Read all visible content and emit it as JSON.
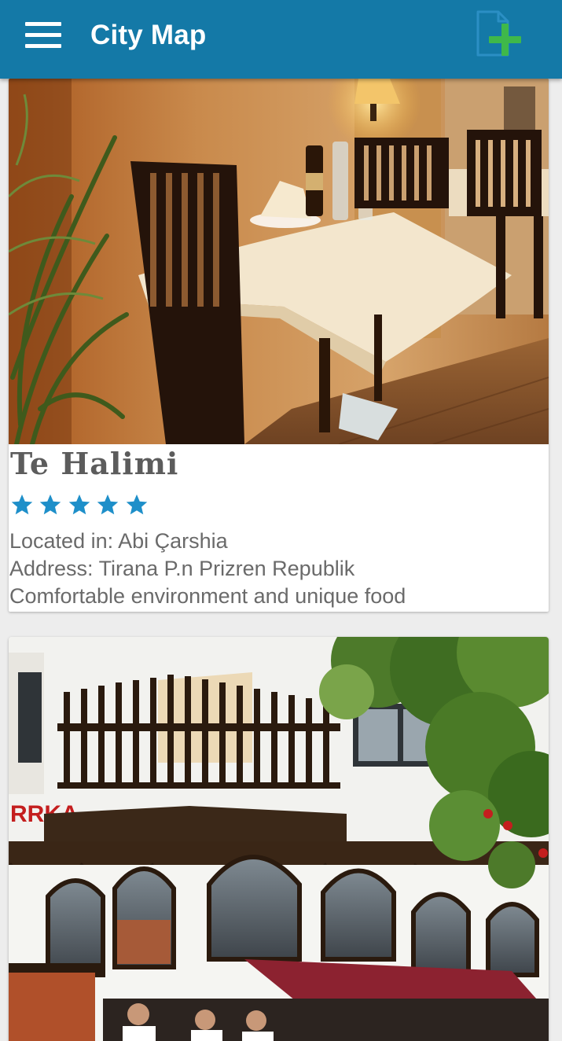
{
  "app": {
    "title": "City Map"
  },
  "colors": {
    "appbar": "#1479a7",
    "star": "#1e8fc9",
    "add_plus": "#3fb84a"
  },
  "icons": {
    "menu": "hamburger-menu-icon",
    "add": "add-document-icon",
    "star": "star-icon"
  },
  "places": [
    {
      "name": "Te Halimi",
      "rating": 5,
      "location": "Located in: Abi Çarshia",
      "address": "Address: Tirana P.n Prizren Republik",
      "description": "Comfortable environment and unique food"
    },
    {
      "sign_text": "RRKA"
    }
  ]
}
